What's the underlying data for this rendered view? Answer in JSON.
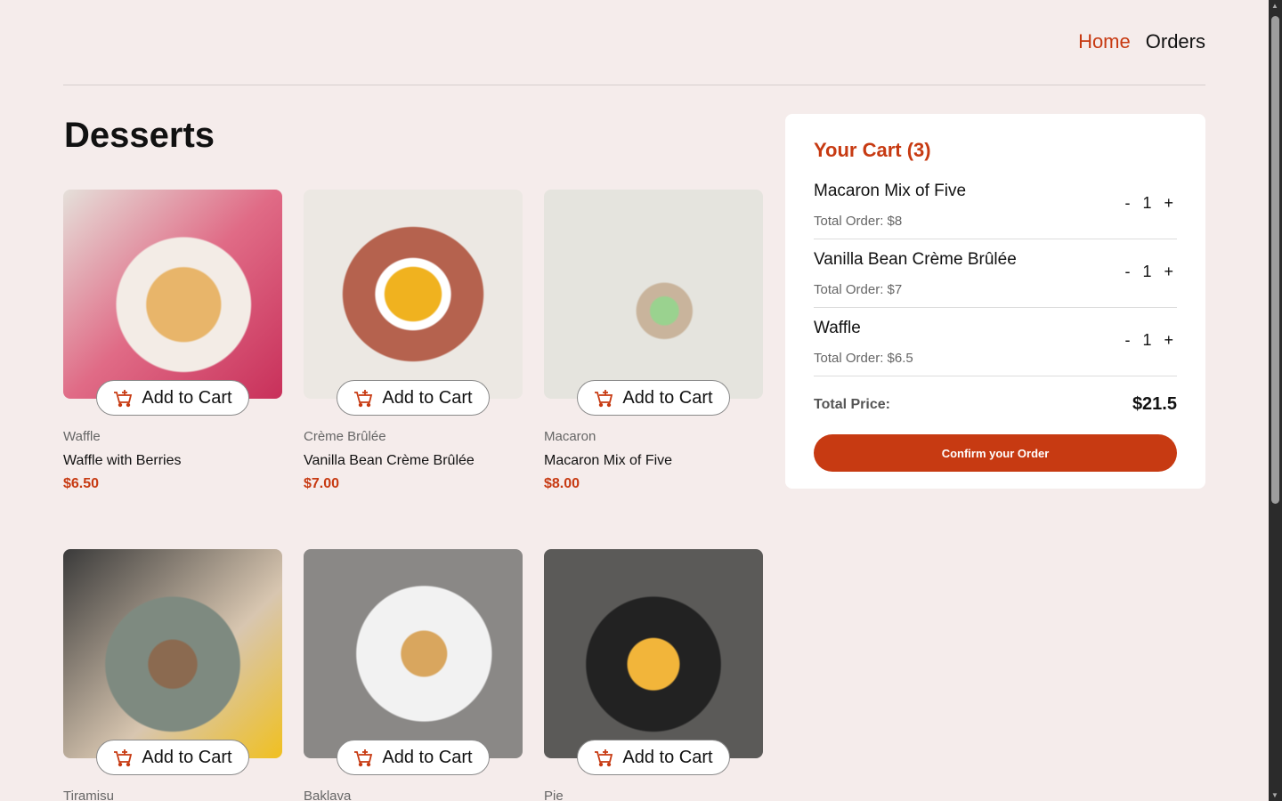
{
  "nav": {
    "home": "Home",
    "orders": "Orders"
  },
  "title": "Desserts",
  "add_label": "Add to Cart",
  "products": [
    {
      "category": "Waffle",
      "name": "Waffle with Berries",
      "price": "$6.50"
    },
    {
      "category": "Crème Brûlée",
      "name": "Vanilla Bean Crème Brûlée",
      "price": "$7.00"
    },
    {
      "category": "Macaron",
      "name": "Macaron Mix of Five",
      "price": "$8.00"
    },
    {
      "category": "Tiramisu",
      "name": "",
      "price": ""
    },
    {
      "category": "Baklava",
      "name": "",
      "price": ""
    },
    {
      "category": "Pie",
      "name": "",
      "price": ""
    }
  ],
  "cart": {
    "title": "Your Cart (3)",
    "items": [
      {
        "name": "Macaron Mix of Five",
        "total": "Total Order: $8",
        "qty": "1"
      },
      {
        "name": "Vanilla Bean Crème Brûlée",
        "total": "Total Order: $7",
        "qty": "1"
      },
      {
        "name": "Waffle",
        "total": "Total Order: $6.5",
        "qty": "1"
      }
    ],
    "minus": "-",
    "plus": "+",
    "total_label": "Total Price:",
    "total_value": "$21.5",
    "confirm": "Confirm your Order"
  },
  "colors": {
    "accent": "#c73a12",
    "bg": "#f5eceb"
  }
}
